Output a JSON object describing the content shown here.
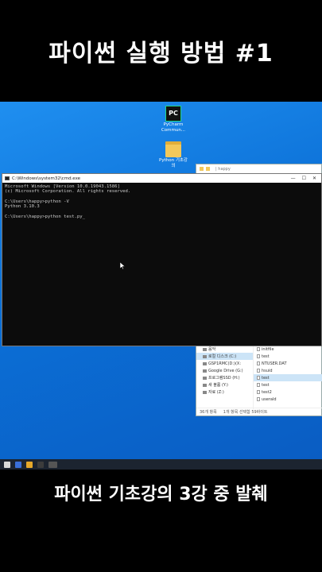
{
  "headline": "파이썬 실행 방법 #1",
  "caption": "파이썬 기초강의 3강 중 발췌",
  "desktop": {
    "icons": [
      {
        "name": "pycharm",
        "glyph": "PC",
        "label": "PyCharm Commun..."
      },
      {
        "name": "folder",
        "label": "Python 기초강의"
      }
    ]
  },
  "explorer": {
    "title_path": "| happy",
    "nav_items": [
      "음악",
      "로컬 디스크 (C:)",
      "GSP1RMC(D:)(X:",
      "Google Drive (G:)",
      "프로그램SSD (H:)",
      "새 볼륨 (Y:)",
      "자료 (Z:)"
    ],
    "files": [
      "initfile",
      "test",
      "NTUSER.DAT",
      "hsuid",
      "test",
      "test",
      "test2",
      "userald"
    ],
    "selected_file_index": 4,
    "status_items": "36개 항목",
    "status_selected": "1개 항목 선택함 59바이트"
  },
  "cmd": {
    "title": "C:\\Windows\\system32\\cmd.exe",
    "lines": [
      "Microsoft Windows [Version 10.0.19043.1586]",
      "(c) Microsoft Corporation. All rights reserved.",
      "",
      "C:\\Users\\happy>python -V",
      "Python 3.10.3",
      "",
      "C:\\Users\\happy>python test.py_"
    ]
  },
  "colors": {
    "desktop_blue": "#0b6fd6",
    "terminal_bg": "#0c0c0c",
    "terminal_text": "#cccccc",
    "pycharm_green": "#21d789",
    "folder_yellow": "#f2c85a"
  }
}
